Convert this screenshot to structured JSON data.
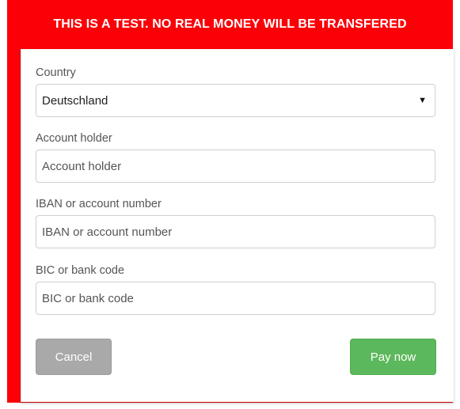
{
  "banner": {
    "text": "THIS IS A TEST. NO REAL MONEY WILL BE TRANSFERED"
  },
  "form": {
    "country": {
      "label": "Country",
      "selected": "Deutschland"
    },
    "account_holder": {
      "label": "Account holder",
      "placeholder": "Account holder",
      "value": ""
    },
    "iban": {
      "label": "IBAN or account number",
      "placeholder": "IBAN or account number",
      "value": ""
    },
    "bic": {
      "label": "BIC or bank code",
      "placeholder": "BIC or bank code",
      "value": ""
    }
  },
  "buttons": {
    "cancel": "Cancel",
    "pay": "Pay now"
  },
  "icons": {
    "dropdown": "caret-down-icon"
  },
  "colors": {
    "banner_bg": "#fb0007",
    "cancel_bg": "#a9a9a9",
    "pay_bg": "#5cb85c"
  }
}
